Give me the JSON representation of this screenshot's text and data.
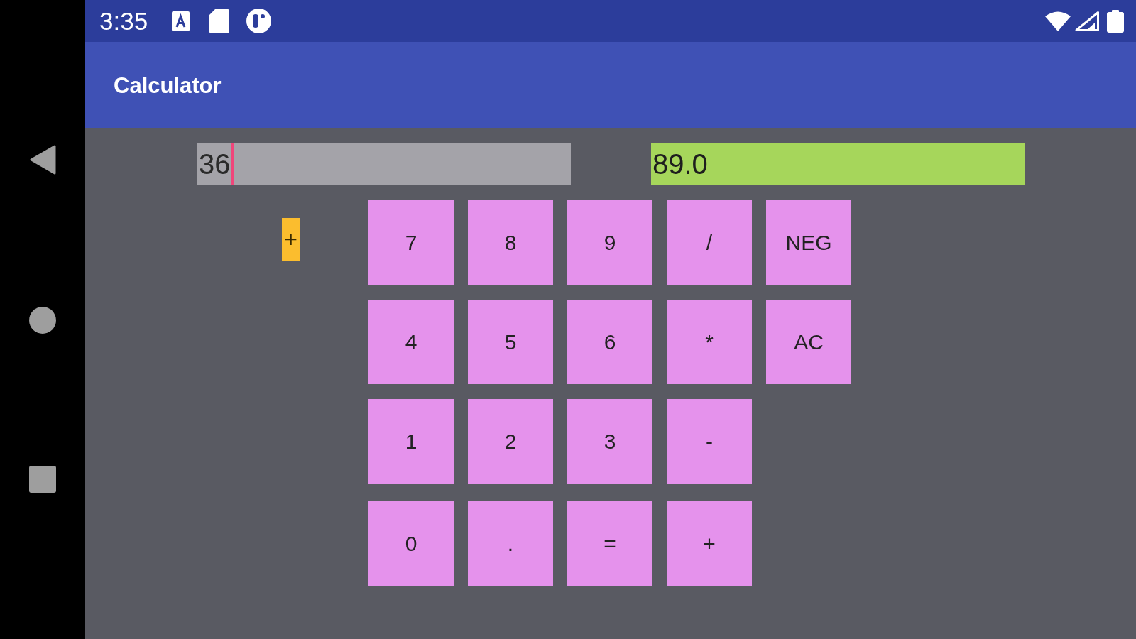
{
  "status_bar": {
    "time": "3:35"
  },
  "app_bar": {
    "title": "Calculator"
  },
  "display": {
    "input": {
      "value": "36",
      "focused": true
    },
    "result": {
      "value": "89.0"
    },
    "operator": "+"
  },
  "keypad": {
    "rows": [
      [
        "7",
        "8",
        "9",
        "/",
        "NEG"
      ],
      [
        "4",
        "5",
        "6",
        "*",
        "AC"
      ],
      [
        "1",
        "2",
        "3",
        "-"
      ],
      [
        "0",
        ".",
        "=",
        "+"
      ]
    ]
  }
}
